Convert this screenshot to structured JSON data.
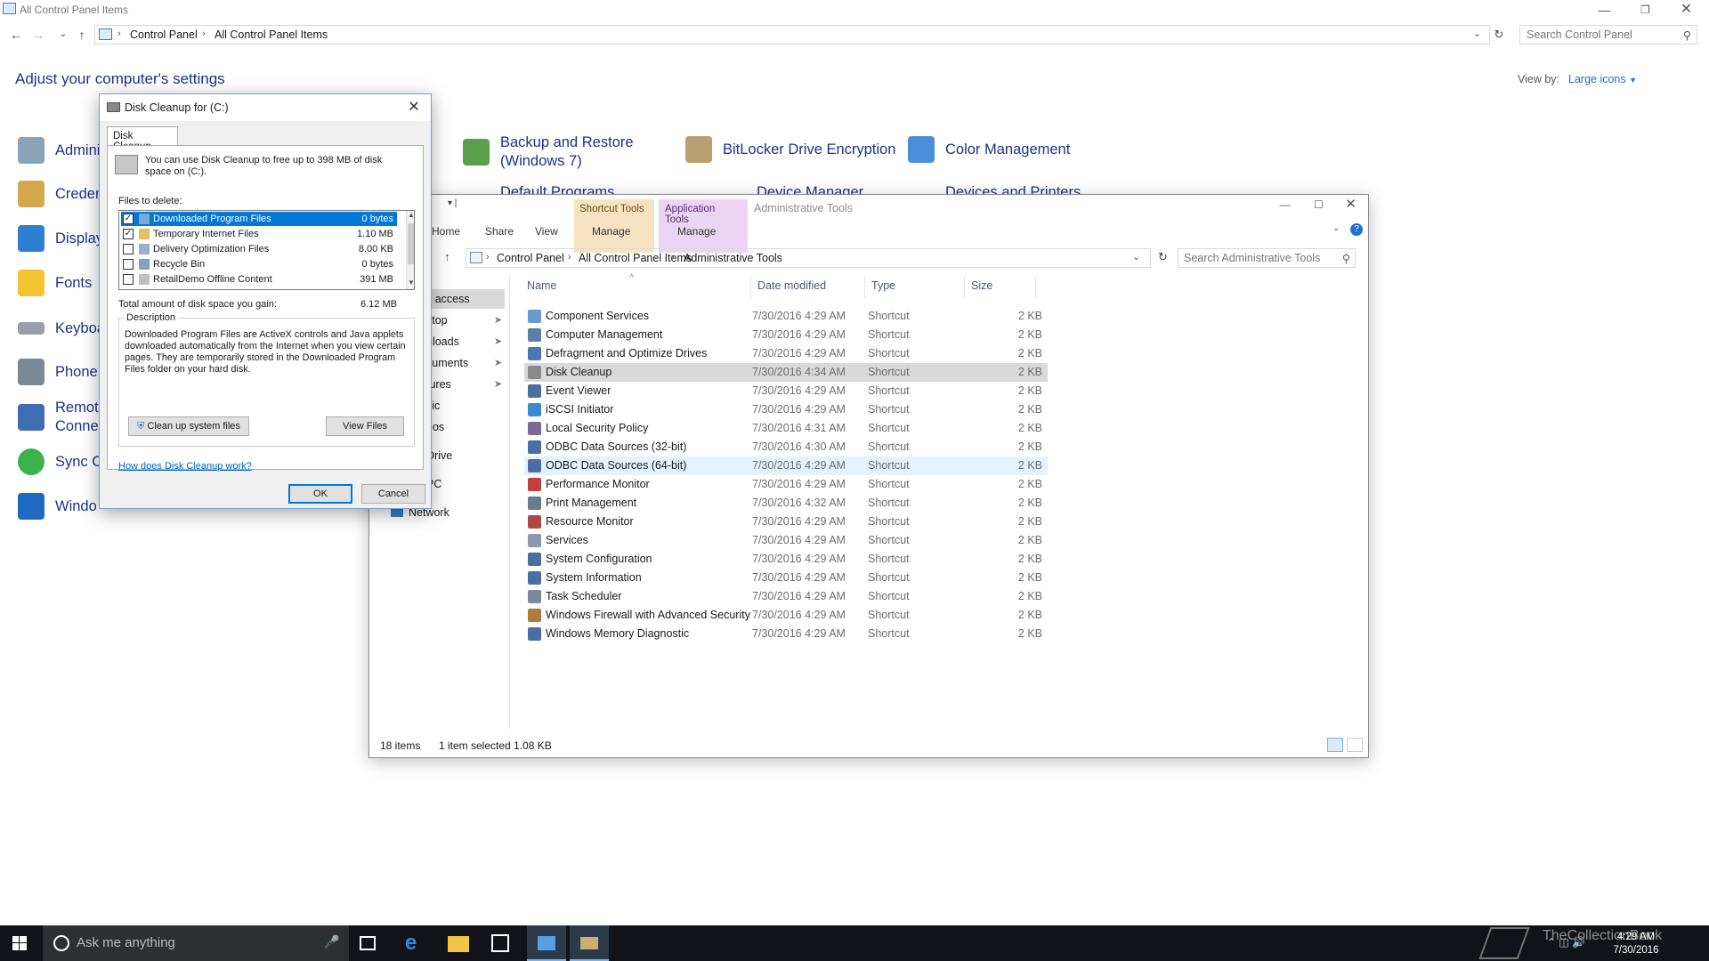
{
  "control_panel": {
    "window_title": "All Control Panel Items",
    "breadcrumb": [
      "Control Panel",
      "All Control Panel Items"
    ],
    "search_placeholder": "Search Control Panel",
    "heading": "Adjust your computer's settings",
    "view_by_label": "View by:",
    "view_by_value": "Large icons",
    "items_left": [
      "Admini",
      "Creden",
      "Display",
      "Fonts",
      "Keyboa",
      "Phone",
      "Remote",
      "Connec",
      "Sync C",
      "Windo"
    ],
    "items_top": [
      {
        "label": "Backup and Restore\n(Windows 7)",
        "line1": "Backup and Restore",
        "line2": "(Windows 7)"
      },
      {
        "label": "BitLocker Drive Encryption"
      },
      {
        "label": "Color Management"
      }
    ],
    "items_partial": [
      "Default Programs",
      "Device Manager",
      "Devices and Printers"
    ],
    "colors": {
      "link_blue": "#1e3287",
      "accent": "#0078d7"
    }
  },
  "explorer": {
    "title": "Administrative Tools",
    "context_tabs": [
      {
        "label": "Shortcut Tools",
        "sub": "Manage",
        "color": "#f7d9a8"
      },
      {
        "label": "Application Tools",
        "sub": "Manage",
        "color": "#e6c8f0"
      }
    ],
    "ribbon_tabs": [
      "Home",
      "Share",
      "View"
    ],
    "breadcrumb": [
      "Control Panel",
      "All Control Panel Items",
      "Administrative Tools"
    ],
    "search_placeholder": "Search Administrative Tools",
    "nav": [
      "k access",
      "ktop",
      "nloads",
      "cuments",
      "tures",
      "sic",
      "eos",
      "Drive",
      "PC",
      "Network"
    ],
    "columns": [
      "Name",
      "Date modified",
      "Type",
      "Size"
    ],
    "files": [
      {
        "name": "Component Services",
        "date": "7/30/2016 4:29 AM",
        "type": "Shortcut",
        "size": "2 KB",
        "icon": "#6b9ad1"
      },
      {
        "name": "Computer Management",
        "date": "7/30/2016 4:29 AM",
        "type": "Shortcut",
        "size": "2 KB",
        "icon": "#5a7fa8"
      },
      {
        "name": "Defragment and Optimize Drives",
        "date": "7/30/2016 4:29 AM",
        "type": "Shortcut",
        "size": "2 KB",
        "icon": "#4a78b4"
      },
      {
        "name": "Disk Cleanup",
        "date": "7/30/2016 4:34 AM",
        "type": "Shortcut",
        "size": "2 KB",
        "icon": "#8a8a8a"
      },
      {
        "name": "Event Viewer",
        "date": "7/30/2016 4:29 AM",
        "type": "Shortcut",
        "size": "2 KB",
        "icon": "#4a6fa0"
      },
      {
        "name": "iSCSI Initiator",
        "date": "7/30/2016 4:29 AM",
        "type": "Shortcut",
        "size": "2 KB",
        "icon": "#3a8ad0"
      },
      {
        "name": "Local Security Policy",
        "date": "7/30/2016 4:31 AM",
        "type": "Shortcut",
        "size": "2 KB",
        "icon": "#7a6a9a"
      },
      {
        "name": "ODBC Data Sources (32-bit)",
        "date": "7/30/2016 4:30 AM",
        "type": "Shortcut",
        "size": "2 KB",
        "icon": "#4a6fa0"
      },
      {
        "name": "ODBC Data Sources (64-bit)",
        "date": "7/30/2016 4:29 AM",
        "type": "Shortcut",
        "size": "2 KB",
        "icon": "#4a6fa0"
      },
      {
        "name": "Performance Monitor",
        "date": "7/30/2016 4:29 AM",
        "type": "Shortcut",
        "size": "2 KB",
        "icon": "#c04040"
      },
      {
        "name": "Print Management",
        "date": "7/30/2016 4:32 AM",
        "type": "Shortcut",
        "size": "2 KB",
        "icon": "#6a7a8a"
      },
      {
        "name": "Resource Monitor",
        "date": "7/30/2016 4:29 AM",
        "type": "Shortcut",
        "size": "2 KB",
        "icon": "#b04848"
      },
      {
        "name": "Services",
        "date": "7/30/2016 4:29 AM",
        "type": "Shortcut",
        "size": "2 KB",
        "icon": "#8a9aaa"
      },
      {
        "name": "System Configuration",
        "date": "7/30/2016 4:29 AM",
        "type": "Shortcut",
        "size": "2 KB",
        "icon": "#4a6fa0"
      },
      {
        "name": "System Information",
        "date": "7/30/2016 4:29 AM",
        "type": "Shortcut",
        "size": "2 KB",
        "icon": "#4a6fa0"
      },
      {
        "name": "Task Scheduler",
        "date": "7/30/2016 4:29 AM",
        "type": "Shortcut",
        "size": "2 KB",
        "icon": "#7a8a9a"
      },
      {
        "name": "Windows Firewall with Advanced Security",
        "date": "7/30/2016 4:29 AM",
        "type": "Shortcut",
        "size": "2 KB",
        "icon": "#b07a3a"
      },
      {
        "name": "Windows Memory Diagnostic",
        "date": "7/30/2016 4:29 AM",
        "type": "Shortcut",
        "size": "2 KB",
        "icon": "#4a6fa0"
      }
    ],
    "selected_file": "Disk Cleanup",
    "status_count": "18 items",
    "status_selection": "1 item selected  1.08 KB"
  },
  "disk_cleanup": {
    "title": "Disk Cleanup for  (C:)",
    "tab": "Disk Cleanup",
    "intro": "You can use Disk Cleanup to free up to 398 MB of disk space on  (C:).",
    "files_label": "Files to delete:",
    "files": [
      {
        "name": "Downloaded Program Files",
        "size": "0 bytes",
        "checked": true,
        "selected": true
      },
      {
        "name": "Temporary Internet Files",
        "size": "1.10 MB",
        "checked": true,
        "selected": false
      },
      {
        "name": "Delivery Optimization Files",
        "size": "8.00 KB",
        "checked": false,
        "selected": false
      },
      {
        "name": "Recycle Bin",
        "size": "0 bytes",
        "checked": false,
        "selected": false
      },
      {
        "name": "RetailDemo Offline Content",
        "size": "391 MB",
        "checked": false,
        "selected": false
      }
    ],
    "total_label": "Total amount of disk space you gain:",
    "total_value": "6.12 MB",
    "description_label": "Description",
    "description": "Downloaded Program Files are ActiveX controls and Java applets downloaded automatically from the Internet when you view certain pages. They are temporarily stored in the Downloaded Program Files folder on your hard disk.",
    "cleanup_system_button": "Clean up system files",
    "view_files_button": "View Files",
    "help_link": "How does Disk Cleanup work?",
    "ok_button": "OK",
    "cancel_button": "Cancel"
  },
  "taskbar": {
    "search_placeholder": "Ask me anything",
    "time": "4:29 AM",
    "date": "7/30/2016",
    "watermark": "TheCollectionBook"
  }
}
